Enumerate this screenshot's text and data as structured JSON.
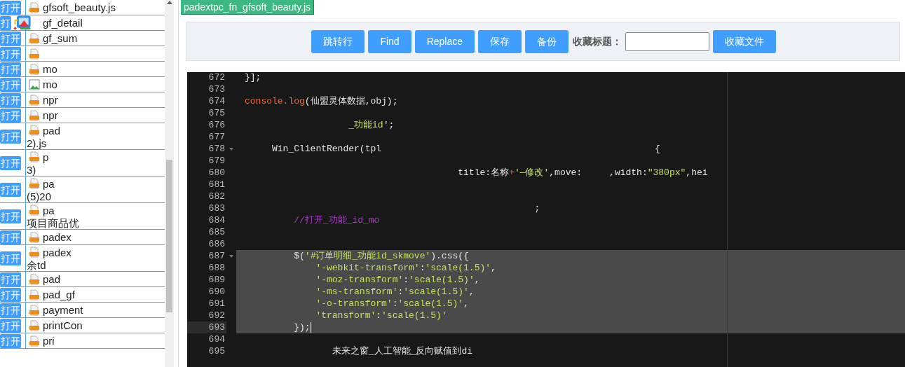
{
  "tab": {
    "label": "padextpc_fn_gfsoft_beauty.js",
    "selected": true
  },
  "files": [
    {
      "button": "打开",
      "kind": "js",
      "lines": [
        "gfsoft_beauty.js"
      ]
    },
    {
      "button": "打",
      "lines": [
        "gf_detail"
      ]
    },
    {
      "button": "打开",
      "kind": "js",
      "lines": [
        "gf_sum"
      ]
    },
    {
      "button": "打开",
      "kind": "js"
    },
    {
      "button": "打开",
      "kind": "js",
      "lines": [
        "mo"
      ]
    },
    {
      "button": "打开",
      "kind": "image",
      "lines": [
        "mo"
      ]
    },
    {
      "button": "打开",
      "kind": "js",
      "lines": [
        "npr"
      ]
    },
    {
      "button": "打开",
      "kind": "js",
      "lines": [
        "npr"
      ]
    },
    {
      "button": "打开",
      "kind": "js",
      "lines": [
        "pad",
        "2).js"
      ]
    },
    {
      "button": "打开",
      "kind": "js",
      "lines": [
        "p",
        "3)"
      ]
    },
    {
      "button": "打开",
      "kind": "js",
      "lines": [
        "pa",
        "(5)20"
      ]
    },
    {
      "button": "打开",
      "kind": "js",
      "lines": [
        "pa",
        "项目商品优"
      ]
    },
    {
      "button": "打开",
      "kind": "js",
      "lines": [
        "padex"
      ]
    },
    {
      "button": "打开",
      "kind": "js",
      "lines": [
        "padex",
        "余td"
      ]
    },
    {
      "button": "打开",
      "kind": "js",
      "lines": [
        "pad"
      ]
    },
    {
      "button": "打开",
      "kind": "js",
      "lines": [
        "pad_gf"
      ]
    },
    {
      "button": "打开",
      "kind": "js",
      "lines": [
        "payment"
      ]
    },
    {
      "button": "打开",
      "kind": "js",
      "lines": [
        "printCon"
      ]
    },
    {
      "button": "打开",
      "kind": "js",
      "lines": [
        "pri"
      ]
    }
  ],
  "toolbar": {
    "buttons": [
      "跳转行",
      "Find",
      "Replace",
      "保存",
      "备份"
    ],
    "favorite_label": "收藏标题：",
    "favorite_button": "收藏文件"
  },
  "editor": {
    "lines": [
      {
        "number": "672",
        "fold": false,
        "selected": false,
        "active": false,
        "tokens": [
          {
            "kind": "plain",
            "text": "}];"
          }
        ]
      },
      {
        "number": "673",
        "fold": false,
        "selected": false,
        "active": false
      },
      {
        "number": "674",
        "fold": false,
        "selected": false,
        "active": false,
        "tokens": [
          {
            "kind": "call",
            "text": "console.log"
          },
          {
            "kind": "plain",
            "text": "(仙盟灵体数据,obj);"
          }
        ]
      },
      {
        "number": "675",
        "fold": false,
        "selected": false,
        "active": false
      },
      {
        "number": "676",
        "fold": false,
        "selected": false,
        "active": false,
        "tokens": [
          {
            "kind": "string",
            "text": "                   _功能id"
          },
          {
            "kind": "plain",
            "text": "';"
          }
        ]
      },
      {
        "number": "677",
        "fold": false,
        "selected": false,
        "active": false
      },
      {
        "number": "678",
        "fold": true,
        "selected": false,
        "active": false,
        "tokens": [
          {
            "kind": "plain",
            "text": "     Win_ClientRender(tpl                                                  {"
          }
        ]
      },
      {
        "number": "679",
        "fold": false,
        "selected": false,
        "active": false
      },
      {
        "number": "680",
        "fold": false,
        "selected": false,
        "active": false,
        "tokens": [
          {
            "kind": "plain",
            "text": "                                       title:名称"
          },
          {
            "kind": "call",
            "text": "+"
          },
          {
            "kind": "string",
            "text": "'—修改'"
          },
          {
            "kind": "plain",
            "text": ",move:     ,width:"
          },
          {
            "kind": "string",
            "text": "\"380px\""
          },
          {
            "kind": "plain",
            "text": ",hei"
          }
        ]
      },
      {
        "number": "681",
        "fold": false,
        "selected": false,
        "active": false
      },
      {
        "number": "682",
        "fold": false,
        "selected": false,
        "active": false
      },
      {
        "number": "683",
        "fold": false,
        "selected": false,
        "active": false,
        "tokens": [
          {
            "kind": "plain",
            "text": "                                                     ;"
          }
        ]
      },
      {
        "number": "684",
        "fold": false,
        "selected": false,
        "active": false,
        "tokens": [
          {
            "kind": "comment",
            "text": "         //打开_功能_id_mo"
          }
        ]
      },
      {
        "number": "685",
        "fold": false,
        "selected": false,
        "active": false
      },
      {
        "number": "686",
        "fold": false,
        "selected": false,
        "active": false
      },
      {
        "number": "687",
        "fold": true,
        "selected": true,
        "active": false,
        "tokens": [
          {
            "kind": "plain",
            "text": "         $("
          },
          {
            "kind": "string",
            "text": "'#订单明细_功能id_skmove'"
          },
          {
            "kind": "plain",
            "text": ").css({"
          }
        ]
      },
      {
        "number": "688",
        "fold": false,
        "selected": true,
        "active": false,
        "tokens": [
          {
            "kind": "string",
            "text": "             '-webkit-transform'"
          },
          {
            "kind": "plain",
            "text": ":"
          },
          {
            "kind": "string",
            "text": "'scale(1.5)'"
          },
          {
            "kind": "plain",
            "text": ","
          }
        ]
      },
      {
        "number": "689",
        "fold": false,
        "selected": true,
        "active": false,
        "tokens": [
          {
            "kind": "string",
            "text": "             '-moz-transform'"
          },
          {
            "kind": "plain",
            "text": ":"
          },
          {
            "kind": "string",
            "text": "'scale(1.5)'"
          },
          {
            "kind": "plain",
            "text": ","
          }
        ]
      },
      {
        "number": "690",
        "fold": false,
        "selected": true,
        "active": false,
        "tokens": [
          {
            "kind": "string",
            "text": "             '-ms-transform'"
          },
          {
            "kind": "plain",
            "text": ":"
          },
          {
            "kind": "string",
            "text": "'scale(1.5)'"
          },
          {
            "kind": "plain",
            "text": ","
          }
        ]
      },
      {
        "number": "691",
        "fold": false,
        "selected": true,
        "active": false,
        "tokens": [
          {
            "kind": "string",
            "text": "             '-o-transform'"
          },
          {
            "kind": "plain",
            "text": ":"
          },
          {
            "kind": "string",
            "text": "'scale(1.5)'"
          },
          {
            "kind": "plain",
            "text": ","
          }
        ]
      },
      {
        "number": "692",
        "fold": false,
        "selected": true,
        "active": false,
        "tokens": [
          {
            "kind": "string",
            "text": "             'transform'"
          },
          {
            "kind": "plain",
            "text": ":"
          },
          {
            "kind": "string",
            "text": "'scale(1.5)'"
          }
        ]
      },
      {
        "number": "693",
        "fold": false,
        "selected": true,
        "active": true,
        "tokens": [
          {
            "kind": "plain",
            "text": "         });"
          }
        ]
      },
      {
        "number": "694",
        "fold": false,
        "selected": false,
        "active": false
      },
      {
        "number": "695",
        "fold": false,
        "selected": false,
        "active": false,
        "tokens": [
          {
            "kind": "plain",
            "text": "                未来之窗_人工智能_反向赋值到di"
          }
        ]
      }
    ]
  }
}
